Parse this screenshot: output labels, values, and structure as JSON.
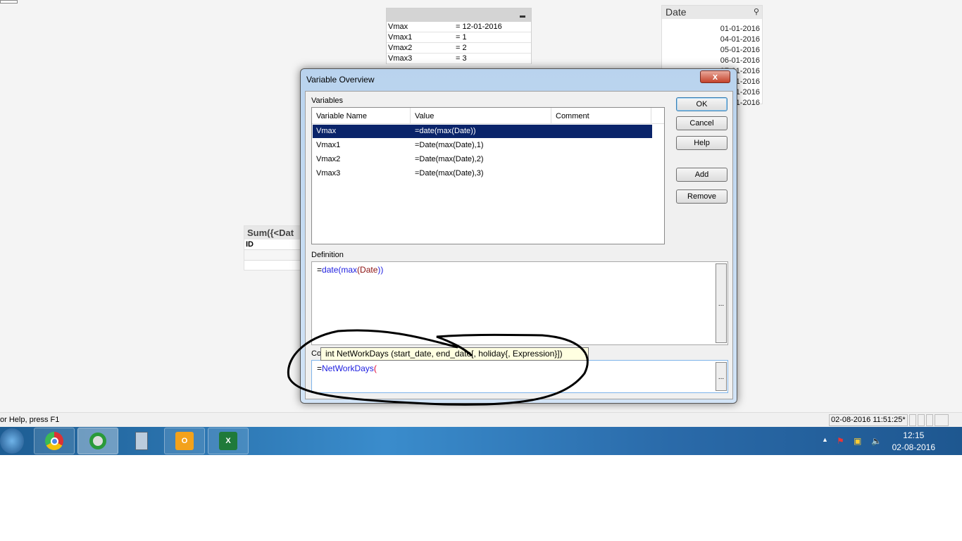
{
  "variables_table": {
    "rows": [
      {
        "name": "Vmax",
        "value": "= 12-01-2016"
      },
      {
        "name": "Vmax1",
        "value": "= 1"
      },
      {
        "name": "Vmax2",
        "value": "= 2"
      },
      {
        "name": "Vmax3",
        "value": "= 3"
      }
    ]
  },
  "date_listbox": {
    "title": "Date",
    "items": [
      "01-01-2016",
      "04-01-2016",
      "05-01-2016",
      "06-01-2016",
      "07-01-2016",
      "1-2016",
      "1-2016",
      "1-2016"
    ]
  },
  "chart": {
    "title": "Sum({<Dat",
    "column": "ID"
  },
  "dialog": {
    "title": "Variable Overview",
    "close": "x",
    "variables_label": "Variables",
    "columns": [
      "Variable Name",
      "Value",
      "Comment"
    ],
    "rows": [
      {
        "name": "Vmax",
        "value": "=date(max(Date))",
        "comment": ""
      },
      {
        "name": "Vmax1",
        "value": "=Date(max(Date),1)",
        "comment": ""
      },
      {
        "name": "Vmax2",
        "value": "=Date(max(Date),2)",
        "comment": ""
      },
      {
        "name": "Vmax3",
        "value": "=Date(max(Date),3)",
        "comment": ""
      }
    ],
    "buttons": {
      "ok": "OK",
      "cancel": "Cancel",
      "help": "Help",
      "add": "Add",
      "remove": "Remove"
    },
    "definition_label": "Definition",
    "definition": {
      "eq": "=",
      "f1": "date",
      "p1": "(",
      "f2": "max",
      "p2": "(",
      "field": "Date",
      "p3": "))"
    },
    "comment_label": "Co",
    "comment": {
      "eq": "=",
      "fn": "NetWorkDays",
      "paren": "("
    },
    "tooltip": "int NetWorkDays (start_date, end_date[, holiday{, Expression}])",
    "browse": "..."
  },
  "status": {
    "help": "or Help, press F1",
    "timestamp": "02-08-2016 11:51:25*"
  },
  "taskbar": {
    "apps": [
      "windows-start",
      "chrome",
      "qlikview",
      "calculator",
      "outlook",
      "excel"
    ],
    "time": "12:15",
    "date": "02-08-2016"
  }
}
